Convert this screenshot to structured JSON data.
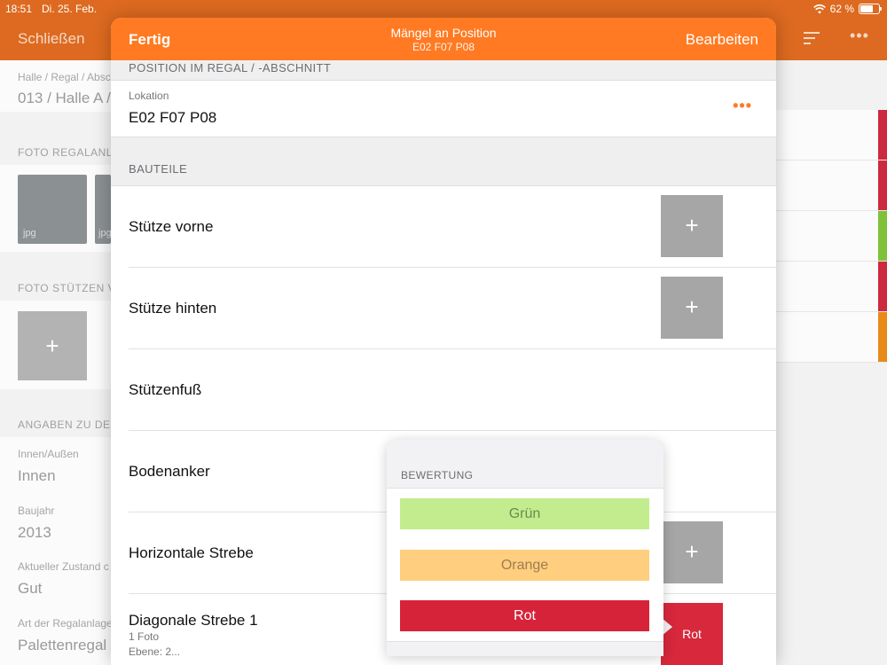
{
  "status_bar": {
    "time": "18:51",
    "date": "Di. 25. Feb.",
    "battery": "62 %",
    "battery_level": 0.62
  },
  "background": {
    "close_label": "Schließen",
    "fields": [
      {
        "label": "Halle / Regal / Absc",
        "value": "013 / Halle A /"
      },
      {
        "label": "Innen/Außen",
        "value": "Innen"
      },
      {
        "label": "Baujahr",
        "value": "2013"
      },
      {
        "label": "Aktueller Zustand c",
        "value": "Gut"
      },
      {
        "label": "Art der Regalanlage",
        "value": "Palettenregal"
      }
    ],
    "sections": [
      "FOTO REGALANLA",
      "FOTO STÜTZEN V",
      "ANGABEN ZU DEF"
    ],
    "thumb_label": "jpg",
    "add_symbol": "+",
    "status_colors": [
      "#cc2a3f",
      "#cc2a3f",
      "#7fc23a",
      "#cc2a3f",
      "#e88a1a"
    ]
  },
  "modal": {
    "done_label": "Fertig",
    "title": "Mängel an Position",
    "subtitle": "E02 F07 P08",
    "edit_label": "Bearbeiten",
    "position_section": "POSITION IM REGAL / -ABSCHNITT",
    "location_label": "Lokation",
    "location_value": "E02 F07 P08",
    "more_symbol": "•••",
    "parts_section": "BAUTEILE",
    "parts": [
      {
        "name": "Stütze vorne",
        "button": "+"
      },
      {
        "name": "Stütze hinten",
        "button": "+"
      },
      {
        "name": "Stützenfuß"
      },
      {
        "name": "Bodenanker"
      },
      {
        "name": "Horizontale Strebe",
        "button": "+"
      },
      {
        "name": "Diagonale Strebe 1",
        "photos": "1 Foto",
        "level": "Ebene: 2...",
        "rating": "Rot"
      }
    ]
  },
  "rating_popover": {
    "header": "BEWERTUNG",
    "options": [
      {
        "label": "Grün",
        "color": "#c2ec8d"
      },
      {
        "label": "Orange",
        "color": "#ffce7e"
      },
      {
        "label": "Rot",
        "color": "#d7233a"
      }
    ]
  }
}
